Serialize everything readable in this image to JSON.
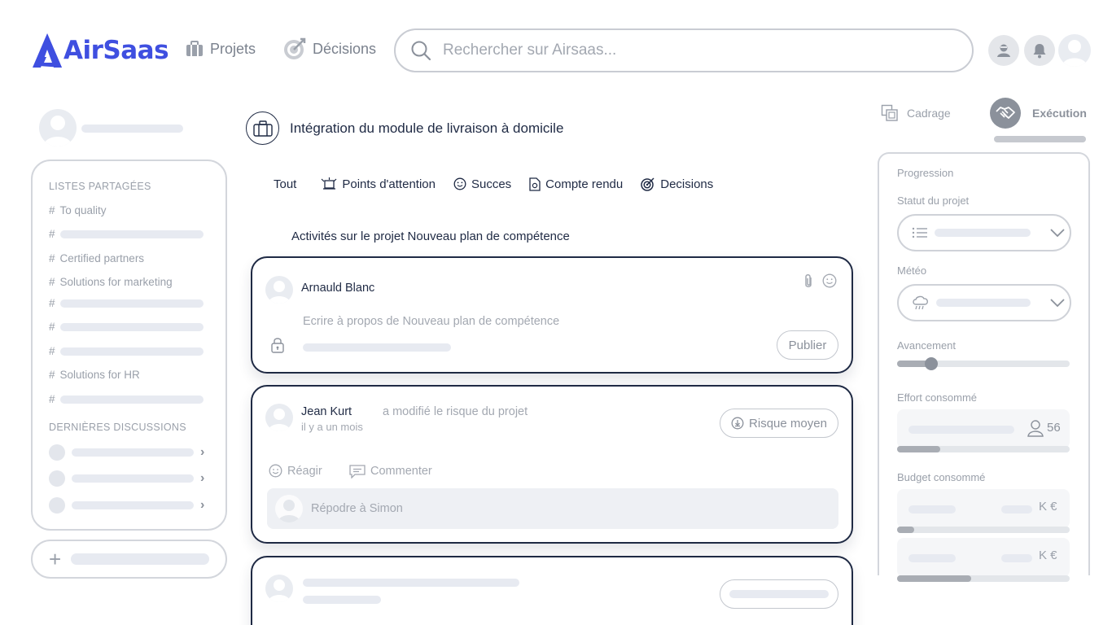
{
  "header": {
    "logo_text": "AirSaas",
    "nav": [
      {
        "label": "Projets",
        "icon": "briefcase-icon"
      },
      {
        "label": "Décisions",
        "icon": "target-icon"
      }
    ],
    "search_placeholder": "Rechercher sur Airsaas..."
  },
  "sidebar": {
    "shared_lists_heading": "LISTES PARTAGÉES",
    "lists": [
      {
        "hash": "#",
        "label": "To quality"
      },
      {
        "hash": "#",
        "label": ""
      },
      {
        "hash": "#",
        "label": "Certified partners"
      },
      {
        "hash": "#",
        "label": "Solutions for marketing"
      },
      {
        "hash": "#",
        "label": ""
      },
      {
        "hash": "#",
        "label": ""
      },
      {
        "hash": "#",
        "label": ""
      },
      {
        "hash": "#",
        "label": "Solutions for HR"
      },
      {
        "hash": "#",
        "label": ""
      }
    ],
    "discussions_heading": "DERNIÈRES DISCUSSIONS",
    "chevron": "›",
    "add_symbol": "+"
  },
  "project": {
    "title": "Intégration du module de livraison à domicile",
    "tabs": [
      {
        "label": "Tout"
      },
      {
        "label": "Points d'attention"
      },
      {
        "label": "Succes"
      },
      {
        "label": "Compte rendu"
      },
      {
        "label": "Decisions"
      }
    ],
    "activity_title": "Activités sur le projet Nouveau plan de compétence"
  },
  "composer": {
    "author": "Arnauld Blanc",
    "placeholder": "Ecrire à propos de Nouveau plan de compétence",
    "publish_label": "Publier"
  },
  "activity": {
    "author": "Jean Kurt",
    "action": "a modifié le risque du projet",
    "time": "il y a un mois",
    "risk_label": "Risque moyen",
    "react_label": "Réagir",
    "comment_label": "Commenter",
    "reply_placeholder": "Répodre à Simon"
  },
  "phases": {
    "cadrage": "Cadrage",
    "execution": "Exécution"
  },
  "progression": {
    "title": "Progression",
    "status_label": "Statut du projet",
    "meteo_label": "Météo",
    "avancement_label": "Avancement",
    "avancement_fraction": 0.2,
    "effort_label": "Effort consommé",
    "effort_value": "56",
    "effort_fraction": 0.25,
    "budget_label": "Budget consommé",
    "budget_unit_1": "K €",
    "budget_fraction_1": 0.1,
    "budget_unit_2": "K €",
    "budget_fraction_2": 0.43
  }
}
